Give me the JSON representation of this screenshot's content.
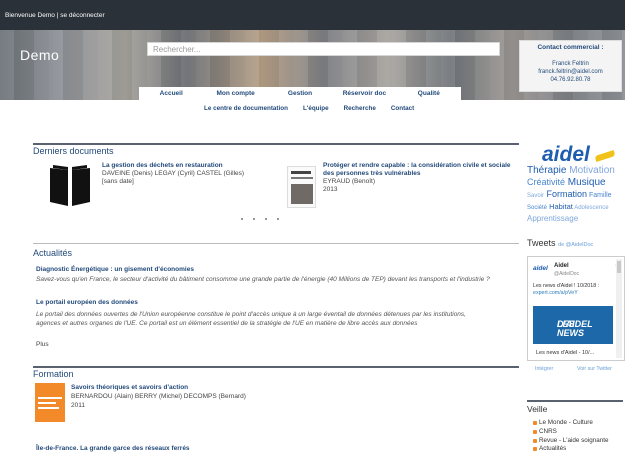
{
  "topbar": {
    "welcome": "Bienvenue Demo",
    "separator": " | ",
    "logout": "se déconnecter"
  },
  "header": {
    "logo": "Demo",
    "search_placeholder": "Rechercher...",
    "contact": {
      "title": "Contact commercial :",
      "name": "Franck Feltrin",
      "email": "franck.feltrin@aidel.com",
      "phone": "04.76.92.80.78"
    }
  },
  "nav": {
    "main": [
      "Accueil",
      "Mon compte",
      "Gestion",
      "Réservoir doc",
      "Qualité"
    ],
    "sub": [
      "Le centre de documentation",
      "L'équipe",
      "Recherche",
      "Contact"
    ]
  },
  "documents": {
    "title": "Derniers documents",
    "items": [
      {
        "title": "La gestion des déchets en restauration",
        "authors": "DAVEINE (Denis) LEGAY (Cyril) CASTEL (Gilles)",
        "date": "[sans date]"
      },
      {
        "title_line1": "Protéger et rendre capable : la considération civile et sociale",
        "title_line2": "des personnes très vulnérables",
        "authors": "EYRAUD (Benoît)",
        "date": "2013"
      }
    ]
  },
  "news": {
    "title": "Actualités",
    "items": [
      {
        "title": "Diagnostic Énergétique : un gisement d'économies",
        "text": "Savez-vous qu'en France, le secteur d'activité du bâtiment consomme une grande partie de l'énergie (40 Millions de TEP) devant les transports et l'industrie ?"
      },
      {
        "title": "Le portail européen des données",
        "text_line1": "Le portail des données ouvertes de l'Union européenne constitue le point d'accès unique à un large éventail de données détenues par les institutions,",
        "text_line2": "agences et autres organes de l'UE. Ce portail est un élément essentiel de la stratégie de l'UE en matière de libre accès aux données"
      }
    ],
    "more": "Plus"
  },
  "training": {
    "title": "Formation",
    "item": {
      "title": "Savoirs théoriques et savoirs d'action",
      "authors": "BERNARDOU (Alain) BERRY (Michel) DECOMPS (Bernard)",
      "date": "2011"
    },
    "next": "Île-de-France. La grande garce des réseaux ferrés"
  },
  "sidebar": {
    "brand": "aidel",
    "tags": [
      [
        {
          "t": "Thérapie",
          "c": "#1f5db0",
          "s": 10
        },
        {
          "t": "Motivation",
          "c": "#7fa7dc",
          "s": 10
        }
      ],
      [
        {
          "t": "Créativité",
          "c": "#4a86cf",
          "s": 9
        },
        {
          "t": "Musique",
          "c": "#1f5db0",
          "s": 10
        }
      ],
      [
        {
          "t": "Savoir",
          "c": "#7fa7dc",
          "s": 6
        },
        {
          "t": "Formation",
          "c": "#1f5db0",
          "s": 9
        },
        {
          "t": "Famille",
          "c": "#4a86cf",
          "s": 7
        }
      ],
      [
        {
          "t": "Société",
          "c": "#4a86cf",
          "s": 6
        },
        {
          "t": "Habitat",
          "c": "#1f5db0",
          "s": 7.5
        },
        {
          "t": "Adolescence",
          "c": "#7fa7dc",
          "s": 6
        }
      ],
      [
        {
          "t": "Apprentissage",
          "c": "#7fa7dc",
          "s": 8
        }
      ]
    ],
    "tweets": {
      "title": "Tweets",
      "by": "de @AidelDoc",
      "name": "Aidel",
      "handle": "@AidelDoc",
      "text": "Les news d'Aidel ! 10/2018 :",
      "link": "expert.com/a/pVeY",
      "image_text_1": "LES NEWS",
      "image_text_2": "D'AIDEL",
      "caption": "Les news d'Aidel - 10/...",
      "embed": "Intégrer",
      "view": "Voir sur Twitter"
    },
    "veille": {
      "title": "Veille",
      "feeds": [
        "Le Monde - Culture",
        "CNRS",
        "Revue - L'aide soignante",
        "Actualités"
      ]
    }
  }
}
